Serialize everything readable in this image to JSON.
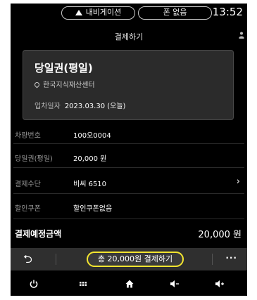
{
  "status": {
    "nav_label": "내비게이션",
    "phone_label": "폰 없음",
    "time": "13:52"
  },
  "title": "결제하기",
  "ticket": {
    "name": "당일권(평일)",
    "place": "한국지식재산센터",
    "date_label": "입차일자",
    "date_value": "2023.03.30 (오늘)"
  },
  "rows": [
    {
      "key": "차량번호",
      "value": "100오0004"
    },
    {
      "key": "당일권(평일)",
      "value": "20,000 원"
    },
    {
      "key": "결제수단",
      "value": "비씨 6510"
    },
    {
      "key": "할인쿠폰",
      "value": "할인쿠폰없음"
    }
  ],
  "total": {
    "label": "결제예정금액",
    "value": "20,000 원"
  },
  "pay_button": "총 20,000원 결제하기",
  "accent_color": "#f3e52f",
  "bottom_icons": [
    "power-icon",
    "apps-icon",
    "home-icon",
    "volume-down-icon",
    "volume-up-icon"
  ]
}
